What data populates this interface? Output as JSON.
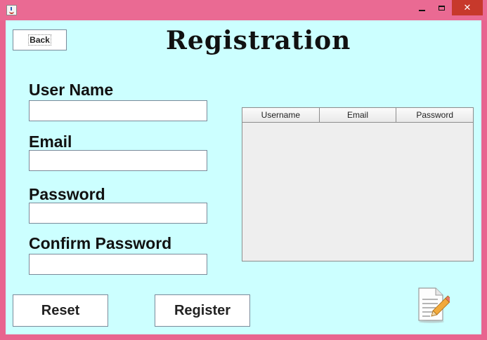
{
  "window": {
    "title": "",
    "controls": {
      "minimize_icon": "minimize-icon",
      "maximize_icon": "maximize-icon",
      "close_icon": "close-icon",
      "close_glyph": "✕"
    }
  },
  "header": {
    "back_label": "Back",
    "title": "Registration"
  },
  "form": {
    "username_label": "User Name",
    "username_value": "",
    "email_label": "Email",
    "email_value": "",
    "password_label": "Password",
    "password_value": "",
    "confirm_label": "Confirm Password",
    "confirm_value": ""
  },
  "table": {
    "columns": [
      "Username",
      "Email",
      "Password"
    ],
    "rows": []
  },
  "actions": {
    "reset_label": "Reset",
    "register_label": "Register"
  },
  "icons": {
    "app": "java-app-icon",
    "document": "document-edit-icon"
  },
  "colors": {
    "frame": "#e8648f",
    "background": "#ccffff",
    "close": "#c7392b",
    "table_bg": "#eeeeee"
  }
}
